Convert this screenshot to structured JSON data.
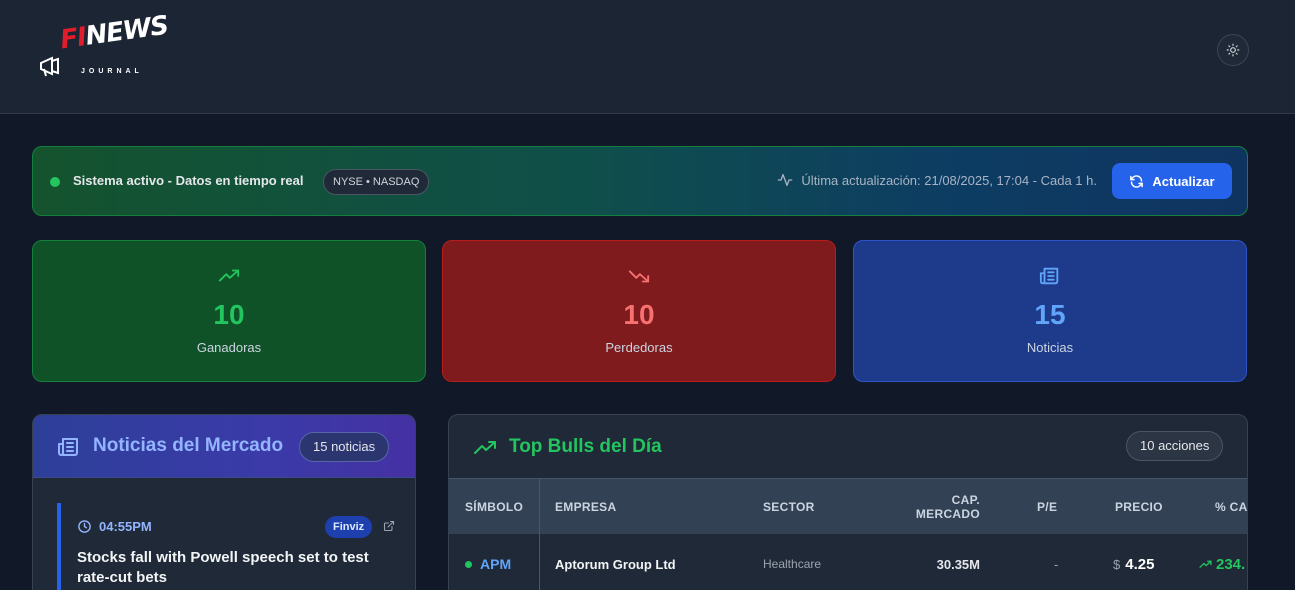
{
  "header": {
    "logo_text_a": "FI",
    "logo_text_b": "NEWS",
    "logo_sub": "JOURNAL",
    "theme_icon": "sun-icon"
  },
  "status": {
    "text": "Sistema activo - Datos en tiempo real",
    "markets": "NYSE • NASDAQ",
    "update": "Última actualización: 21/08/2025, 17:04 - Cada 1 h.",
    "refresh_label": "Actualizar"
  },
  "stats": [
    {
      "value": "10",
      "label": "Ganadoras",
      "icon": "trending-up-icon",
      "color": "#22c55e"
    },
    {
      "value": "10",
      "label": "Perdedoras",
      "icon": "trending-down-icon",
      "color": "#f87171"
    },
    {
      "value": "15",
      "label": "Noticias",
      "icon": "newspaper-icon",
      "color": "#60a5fa"
    }
  ],
  "news": {
    "title": "Noticias del Mercado",
    "count": "15 noticias",
    "items": [
      {
        "time": "04:55PM",
        "source": "Finviz",
        "headline": "Stocks fall with Powell speech set to test rate-cut bets"
      }
    ]
  },
  "bulls": {
    "title": "Top Bulls del Día",
    "count": "10 acciones",
    "columns": [
      "SÍMBOLO",
      "EMPRESA",
      "SECTOR",
      "CAP. MERCADO",
      "P/E",
      "PRECIO",
      "% CA"
    ],
    "rows": [
      {
        "symbol": "APM",
        "company": "Aptorum Group Ltd",
        "sector": "Healthcare",
        "cap": "30.35M",
        "pe": "-",
        "currency": "$",
        "price": "4.25",
        "change": "234."
      }
    ]
  }
}
